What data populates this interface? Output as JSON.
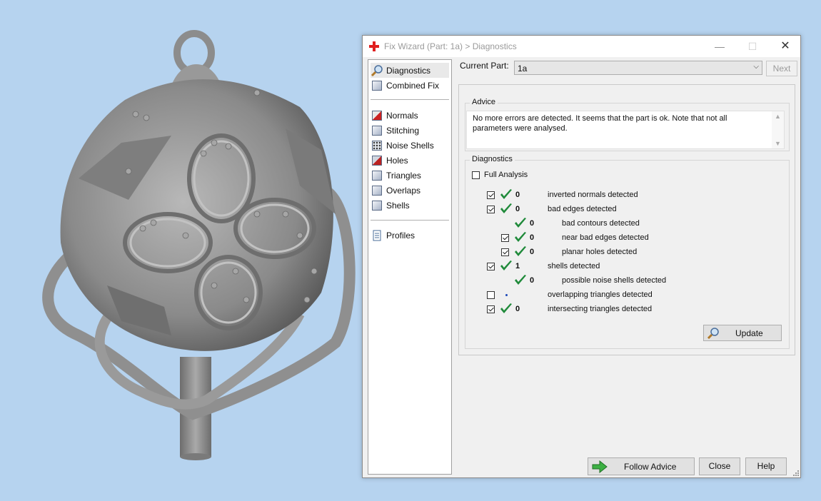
{
  "window": {
    "title": "Fix Wizard (Part: 1a) > Diagnostics",
    "minimize_glyph": "—",
    "maximize_glyph": "☐",
    "close_glyph": "✕",
    "accent_color": "#e02020"
  },
  "sidebar": {
    "items": [
      {
        "label": "Diagnostics",
        "icon": "magnifier-icon"
      },
      {
        "label": "Combined Fix",
        "icon": "combined-fix-icon"
      },
      {
        "label": "Normals",
        "icon": "normals-cube-icon"
      },
      {
        "label": "Stitching",
        "icon": "stitching-icon"
      },
      {
        "label": "Noise Shells",
        "icon": "noise-shells-icon"
      },
      {
        "label": "Holes",
        "icon": "holes-icon"
      },
      {
        "label": "Triangles",
        "icon": "triangles-icon"
      },
      {
        "label": "Overlaps",
        "icon": "overlaps-icon"
      },
      {
        "label": "Shells",
        "icon": "shells-icon"
      },
      {
        "label": "Profiles",
        "icon": "profiles-icon"
      }
    ]
  },
  "current_part": {
    "label": "Current Part:",
    "value": "1a",
    "next_label": "Next"
  },
  "advice": {
    "title": "Advice",
    "text": "No more errors are detected. It seems that the part is ok. Note that not all parameters were analysed."
  },
  "diagnostics": {
    "title": "Diagnostics",
    "full_analysis_label": "Full Analysis",
    "full_analysis_checked": false,
    "rows": [
      {
        "checkbox": true,
        "checked": true,
        "ok": true,
        "count": "0",
        "label": "inverted normals detected",
        "indent": 0
      },
      {
        "checkbox": true,
        "checked": true,
        "ok": true,
        "count": "0",
        "label": "bad edges detected",
        "indent": 0
      },
      {
        "checkbox": false,
        "checked": false,
        "ok": true,
        "count": "0",
        "label": "bad contours detected",
        "indent": 1
      },
      {
        "checkbox": true,
        "checked": true,
        "ok": true,
        "count": "0",
        "label": "near bad edges detected",
        "indent": 1
      },
      {
        "checkbox": true,
        "checked": true,
        "ok": true,
        "count": "0",
        "label": "planar holes detected",
        "indent": 1
      },
      {
        "checkbox": true,
        "checked": true,
        "ok": true,
        "count": "1",
        "label": "shells detected",
        "indent": 0
      },
      {
        "checkbox": false,
        "checked": false,
        "ok": true,
        "count": "0",
        "label": "possible noise shells detected",
        "indent": 1
      },
      {
        "checkbox": true,
        "checked": false,
        "ok": false,
        "count": "",
        "label": "overlapping triangles detected",
        "indent": 0
      },
      {
        "checkbox": true,
        "checked": true,
        "ok": true,
        "count": "0",
        "label": "intersecting triangles detected",
        "indent": 0
      }
    ],
    "update_label": "Update"
  },
  "buttons": {
    "follow_advice": "Follow Advice",
    "close": "Close",
    "help": "Help"
  },
  "colors": {
    "desktop_bg": "#b6d3ef",
    "ok_green": "#1f8a3a",
    "model_gray": "#8c8c8c"
  }
}
